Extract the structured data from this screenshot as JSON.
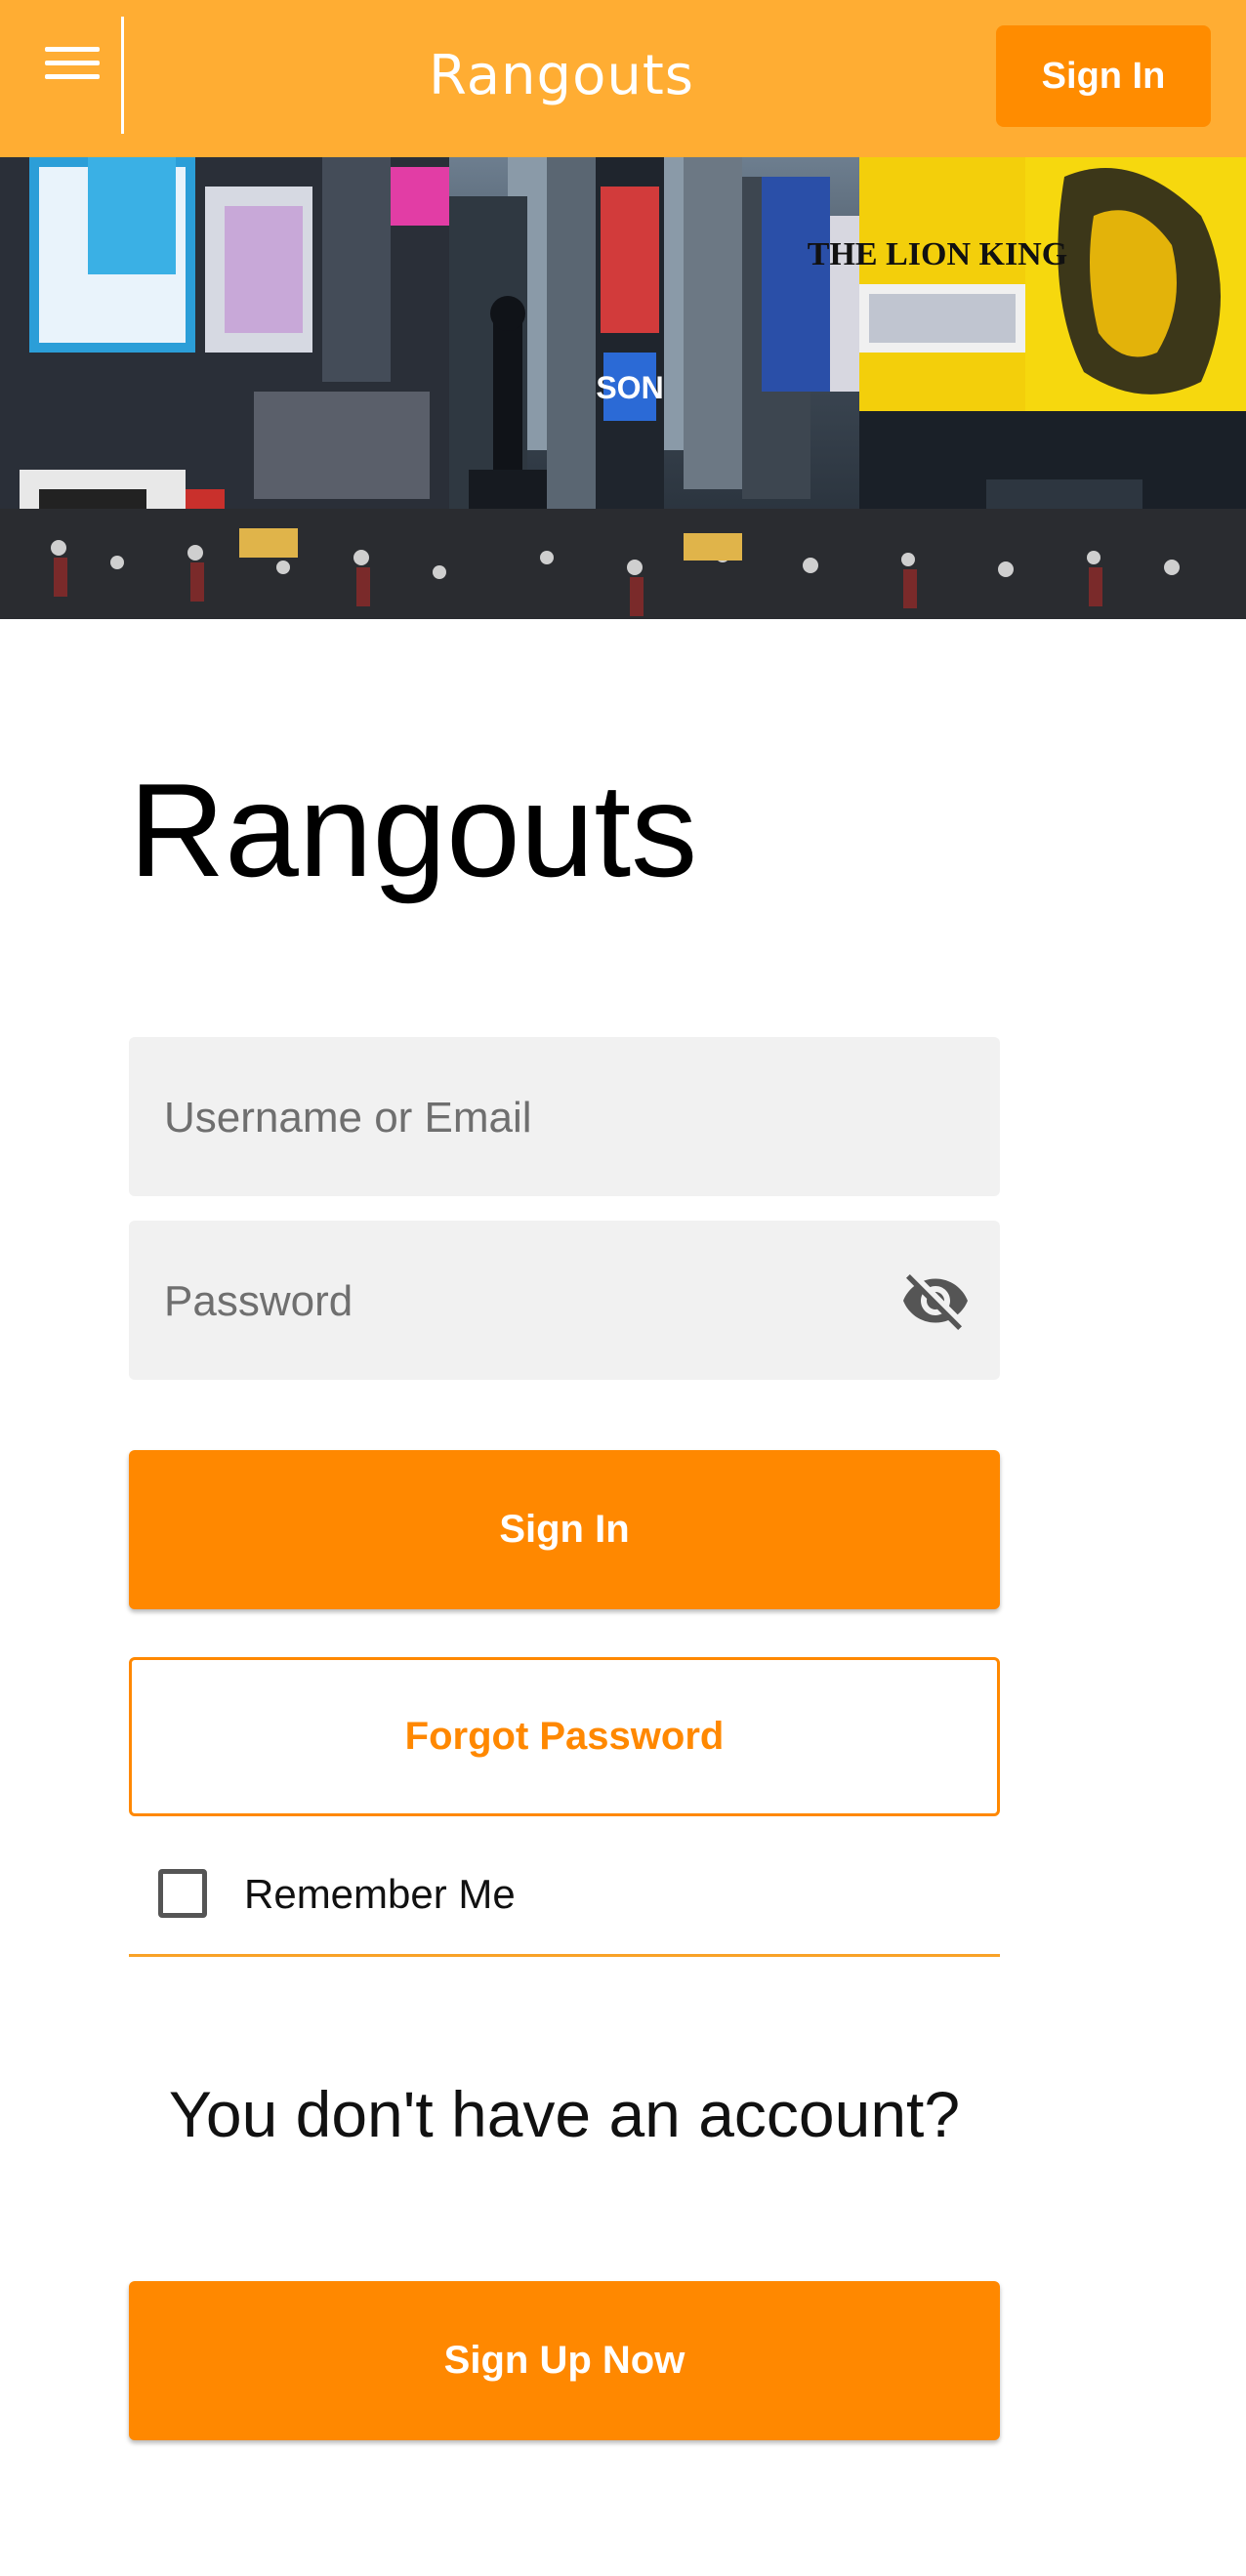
{
  "header": {
    "brand": "Rangouts",
    "signin_label": "Sign In"
  },
  "main": {
    "headline": "Rangouts",
    "username_placeholder": "Username or Email",
    "password_placeholder": "Password",
    "signin_label": "Sign In",
    "forgot_label": "Forgot Password",
    "remember_label": "Remember Me",
    "no_account_text": "You don't have an account?",
    "signup_label": "Sign Up Now"
  },
  "hero": {
    "billboard_lion": "THE LION KING",
    "billboard_son": "SON"
  },
  "colors": {
    "topbar": "#FFAD33",
    "primary": "#FF8800",
    "field_bg": "#F1F1F1",
    "divider": "#F9A227"
  },
  "icons": {
    "menu": "hamburger-menu-icon",
    "eye": "eye-off-icon"
  }
}
